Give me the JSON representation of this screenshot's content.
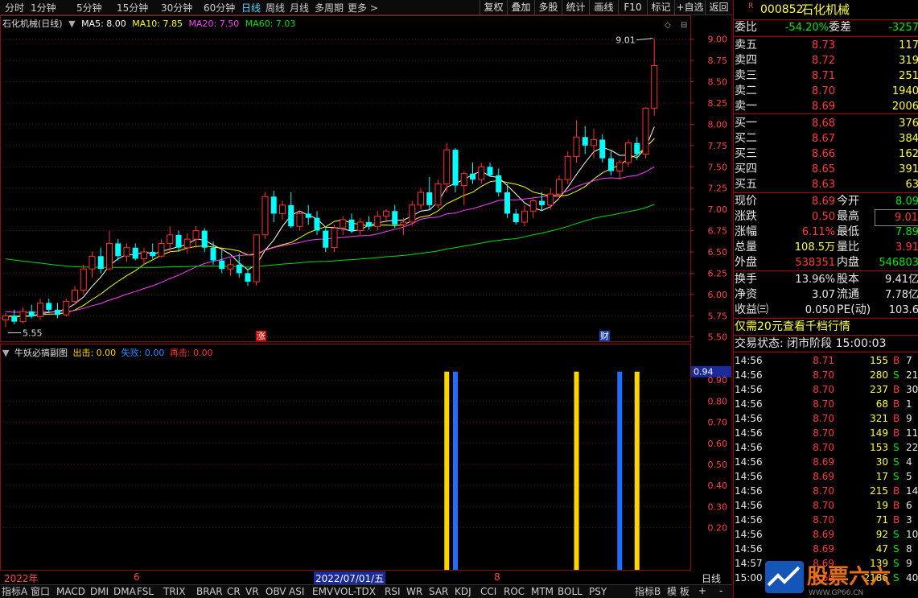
{
  "toolbar": {
    "periods": [
      "分时",
      "1分钟",
      "5分钟",
      "15分钟",
      "30分钟",
      "60分钟",
      "日线",
      "周线",
      "月线",
      "多周期",
      "更多 >"
    ],
    "active_period": "日线",
    "buttons": [
      "复权",
      "叠加",
      "多股",
      "统计",
      "画线",
      "F10",
      "标记",
      "+自选",
      "返回"
    ]
  },
  "main_legend": {
    "title": "石化机械(日线)",
    "ma5": "MA5: 8.00",
    "ma10": "MA10: 7.85",
    "ma20": "MA20: 7.50",
    "ma60": "MA60: 7.03"
  },
  "sub_legend": {
    "title": "牛妖必搞副图",
    "out": "出击: 0.00",
    "fail": "失败: 0.00",
    "again": "再击: 0.00"
  },
  "markers": {
    "high": "9.01",
    "low": "5.55",
    "zhang": "涨",
    "cai": "财"
  },
  "dates": {
    "y2022": "2022年",
    "m6": "6",
    "d0701": "2022/07/01/五",
    "m8": "8"
  },
  "colors": {
    "up": "#ff3030",
    "down": "#00ffff",
    "ma5": "#ffffff",
    "ma10": "#ffff00",
    "ma20": "#ff40ff",
    "ma60": "#00e000",
    "grid": "#6b1515",
    "sig_yellow": "#ffd400",
    "sig_blue": "#1e6fff"
  },
  "chart_data": [
    {
      "type": "candlestick",
      "title": "石化机械(日线)",
      "ylim": [
        5.45,
        9.12
      ],
      "y_ticks": [
        "9.00",
        "8.75",
        "8.50",
        "8.25",
        "8.00",
        "7.75",
        "7.50",
        "7.25",
        "7.00",
        "6.75",
        "6.50",
        "6.25",
        "6.00",
        "5.75",
        "5.50"
      ],
      "ohlc": [
        [
          5.7,
          5.78,
          5.62,
          5.75
        ],
        [
          5.75,
          5.82,
          5.65,
          5.68
        ],
        [
          5.68,
          5.85,
          5.66,
          5.8
        ],
        [
          5.8,
          5.88,
          5.72,
          5.74
        ],
        [
          5.74,
          5.95,
          5.7,
          5.9
        ],
        [
          5.9,
          5.95,
          5.78,
          5.82
        ],
        [
          5.82,
          5.9,
          5.72,
          5.76
        ],
        [
          5.76,
          5.95,
          5.74,
          5.92
        ],
        [
          5.92,
          6.1,
          5.88,
          6.05
        ],
        [
          6.05,
          6.35,
          6.0,
          6.3
        ],
        [
          6.3,
          6.5,
          6.2,
          6.45
        ],
        [
          6.45,
          6.55,
          6.25,
          6.3
        ],
        [
          6.3,
          6.75,
          6.28,
          6.6
        ],
        [
          6.6,
          6.65,
          6.4,
          6.45
        ],
        [
          6.45,
          6.6,
          6.38,
          6.55
        ],
        [
          6.55,
          6.6,
          6.4,
          6.42
        ],
        [
          6.42,
          6.55,
          6.35,
          6.5
        ],
        [
          6.5,
          6.6,
          6.42,
          6.45
        ],
        [
          6.45,
          6.65,
          6.43,
          6.6
        ],
        [
          6.6,
          6.8,
          6.5,
          6.7
        ],
        [
          6.7,
          6.75,
          6.5,
          6.55
        ],
        [
          6.55,
          6.72,
          6.48,
          6.65
        ],
        [
          6.65,
          6.8,
          6.55,
          6.75
        ],
        [
          6.75,
          6.78,
          6.5,
          6.55
        ],
        [
          6.55,
          6.62,
          6.35,
          6.4
        ],
        [
          6.4,
          6.52,
          6.25,
          6.3
        ],
        [
          6.3,
          6.42,
          6.22,
          6.35
        ],
        [
          6.35,
          6.48,
          6.2,
          6.25
        ],
        [
          6.25,
          6.3,
          6.1,
          6.15
        ],
        [
          6.15,
          6.7,
          6.1,
          6.7
        ],
        [
          6.7,
          7.2,
          6.65,
          7.15
        ],
        [
          7.15,
          7.22,
          6.85,
          6.95
        ],
        [
          6.95,
          7.1,
          6.88,
          7.05
        ],
        [
          7.05,
          7.2,
          6.78,
          6.8
        ],
        [
          6.8,
          6.98,
          6.75,
          6.95
        ],
        [
          6.95,
          7.05,
          6.82,
          6.9
        ],
        [
          6.9,
          6.98,
          6.7,
          6.75
        ],
        [
          6.75,
          6.8,
          6.5,
          6.55
        ],
        [
          6.55,
          6.82,
          6.5,
          6.78
        ],
        [
          6.78,
          6.92,
          6.7,
          6.88
        ],
        [
          6.88,
          6.95,
          6.72,
          6.75
        ],
        [
          6.75,
          6.9,
          6.7,
          6.85
        ],
        [
          6.85,
          6.92,
          6.76,
          6.8
        ],
        [
          6.8,
          6.98,
          6.75,
          6.92
        ],
        [
          6.92,
          7.0,
          6.85,
          6.98
        ],
        [
          6.98,
          7.05,
          6.78,
          6.82
        ],
        [
          6.82,
          6.9,
          6.7,
          6.85
        ],
        [
          6.85,
          7.1,
          6.8,
          7.05
        ],
        [
          7.05,
          7.25,
          7.0,
          7.2
        ],
        [
          7.2,
          7.38,
          7.0,
          7.05
        ],
        [
          7.05,
          7.35,
          7.02,
          7.3
        ],
        [
          7.3,
          7.78,
          7.2,
          7.7
        ],
        [
          7.7,
          7.72,
          7.2,
          7.28
        ],
        [
          7.28,
          7.45,
          7.05,
          7.42
        ],
        [
          7.42,
          7.55,
          7.3,
          7.35
        ],
        [
          7.35,
          7.55,
          7.3,
          7.5
        ],
        [
          7.5,
          7.55,
          7.38,
          7.4
        ],
        [
          7.4,
          7.48,
          7.15,
          7.2
        ],
        [
          7.2,
          7.3,
          6.9,
          6.95
        ],
        [
          6.95,
          7.0,
          6.82,
          6.85
        ],
        [
          6.85,
          7.05,
          6.8,
          6.98
        ],
        [
          6.98,
          7.15,
          6.9,
          7.1
        ],
        [
          7.1,
          7.2,
          6.98,
          7.05
        ],
        [
          7.05,
          7.25,
          7.0,
          7.18
        ],
        [
          7.18,
          7.4,
          7.12,
          7.35
        ],
        [
          7.35,
          7.68,
          7.3,
          7.62
        ],
        [
          7.62,
          8.05,
          7.55,
          7.85
        ],
        [
          7.85,
          7.98,
          7.65,
          7.75
        ],
        [
          7.75,
          7.95,
          7.6,
          7.82
        ],
        [
          7.82,
          7.88,
          7.55,
          7.6
        ],
        [
          7.6,
          7.7,
          7.4,
          7.45
        ],
        [
          7.45,
          7.58,
          7.35,
          7.55
        ],
        [
          7.55,
          7.82,
          7.5,
          7.78
        ],
        [
          7.78,
          7.85,
          7.58,
          7.65
        ],
        [
          7.65,
          8.2,
          7.6,
          8.19
        ],
        [
          8.19,
          9.01,
          8.1,
          8.69
        ]
      ],
      "ma": {
        "MA5": "8.00",
        "MA10": "7.85",
        "MA20": "7.50",
        "MA60": "7.03"
      }
    },
    {
      "type": "bar",
      "title": "牛妖必搞副图",
      "ylim": [
        0,
        1.0
      ],
      "y_ticks": [
        "0.94",
        "0.90",
        "0.80",
        "0.70",
        "0.60",
        "0.50",
        "0.40",
        "0.30",
        "0.20"
      ],
      "current_value": "0.94",
      "signals": [
        {
          "index": 51,
          "series": "出击",
          "value": 0.94
        },
        {
          "index": 52,
          "series": "失败",
          "value": 0.94
        },
        {
          "index": 66,
          "series": "出击",
          "value": 0.94
        },
        {
          "index": 71,
          "series": "失败",
          "value": 0.94
        },
        {
          "index": 73,
          "series": "出击",
          "value": 0.94
        }
      ]
    }
  ],
  "axis_right": {
    "period_label": "日线",
    "plus": "+",
    "minus": "-"
  },
  "bottom_tabs": [
    "指标A",
    "窗口",
    "MACD",
    "DMI",
    "DMA",
    "FSL",
    "TRIX",
    "BRAR",
    "CR",
    "VR",
    "OBV",
    "ASI",
    "EMV",
    "VOL-TDX",
    "RSI",
    "WR",
    "SAR",
    "KDJ",
    "CCI",
    "ROC",
    "MTM",
    "BOLL",
    "PSY"
  ],
  "bottom_right": [
    "指标B",
    "模 板"
  ],
  "quote": {
    "r": "R",
    "code": "000852",
    "name": "石化机械",
    "wb": {
      "l1": "委比",
      "v1": "-54.20%",
      "l2": "委差",
      "v2": "-3257"
    },
    "sells": [
      {
        "l": "卖五",
        "p": "8.73",
        "v": "117"
      },
      {
        "l": "卖四",
        "p": "8.72",
        "v": "319"
      },
      {
        "l": "卖三",
        "p": "8.71",
        "v": "251"
      },
      {
        "l": "卖二",
        "p": "8.70",
        "v": "1940"
      },
      {
        "l": "卖一",
        "p": "8.69",
        "v": "2006"
      }
    ],
    "buys": [
      {
        "l": "买一",
        "p": "8.68",
        "v": "376"
      },
      {
        "l": "买二",
        "p": "8.67",
        "v": "384"
      },
      {
        "l": "买三",
        "p": "8.66",
        "v": "162"
      },
      {
        "l": "买四",
        "p": "8.65",
        "v": "391"
      },
      {
        "l": "买五",
        "p": "8.63",
        "v": "63"
      }
    ],
    "stats": [
      {
        "l1": "现价",
        "v1": "8.69",
        "l2": "今开",
        "v2": "8.09"
      },
      {
        "l1": "涨跌",
        "v1": "0.50",
        "l2": "最高",
        "v2": "9.01"
      },
      {
        "l1": "涨幅",
        "v1": "6.11%",
        "l2": "最低",
        "v2": "7.89"
      },
      {
        "l1": "总量",
        "v1": "108.5万",
        "l2": "量比",
        "v2": "3.91"
      },
      {
        "l1": "外盘",
        "v1": "538351",
        "l2": "内盘",
        "v2": "546803"
      }
    ],
    "fund": [
      {
        "l1": "换手",
        "v1": "13.96%",
        "l2": "股本",
        "v2": "9.41亿"
      },
      {
        "l1": "净资",
        "v1": "3.07",
        "l2": "流通",
        "v2": "7.78亿"
      },
      {
        "l1": "收益㈢",
        "v1": "0.050",
        "l2": "PE(动)",
        "v2": "103.6"
      }
    ],
    "promo": "仅需20元查看千档行情",
    "status": "交易状态: 闭市阶段 15:00:03",
    "ticks": [
      {
        "t": "14:56",
        "p": "8.71",
        "v": "155",
        "s": "B",
        "n": "7"
      },
      {
        "t": "14:56",
        "p": "8.70",
        "v": "280",
        "s": "S",
        "n": "21"
      },
      {
        "t": "14:56",
        "p": "8.70",
        "v": "237",
        "s": "B",
        "n": "30"
      },
      {
        "t": "14:56",
        "p": "8.70",
        "v": "68",
        "s": "B",
        "n": "1"
      },
      {
        "t": "14:56",
        "p": "8.70",
        "v": "321",
        "s": "B",
        "n": "9"
      },
      {
        "t": "14:56",
        "p": "8.70",
        "v": "149",
        "s": "B",
        "n": "11"
      },
      {
        "t": "14:56",
        "p": "8.70",
        "v": "153",
        "s": "S",
        "n": "22"
      },
      {
        "t": "14:56",
        "p": "8.69",
        "v": "30",
        "s": "S",
        "n": "4"
      },
      {
        "t": "14:56",
        "p": "8.69",
        "v": "17",
        "s": "S",
        "n": "5"
      },
      {
        "t": "14:56",
        "p": "8.70",
        "v": "215",
        "s": "B",
        "n": "14"
      },
      {
        "t": "14:56",
        "p": "8.70",
        "v": "19",
        "s": "B",
        "n": "6"
      },
      {
        "t": "14:56",
        "p": "8.70",
        "v": "71",
        "s": "B",
        "n": "3"
      },
      {
        "t": "14:56",
        "p": "8.69",
        "v": "92",
        "s": "S",
        "n": "10"
      },
      {
        "t": "14:56",
        "p": "8.69",
        "v": "47",
        "s": "S",
        "n": "8"
      },
      {
        "t": "14:57",
        "p": "8.69",
        "v": "139",
        "s": "S",
        "n": "9"
      },
      {
        "t": "15:00",
        "p": "8.69",
        "v": "2186",
        "s": "S",
        "n": "40"
      }
    ]
  }
}
